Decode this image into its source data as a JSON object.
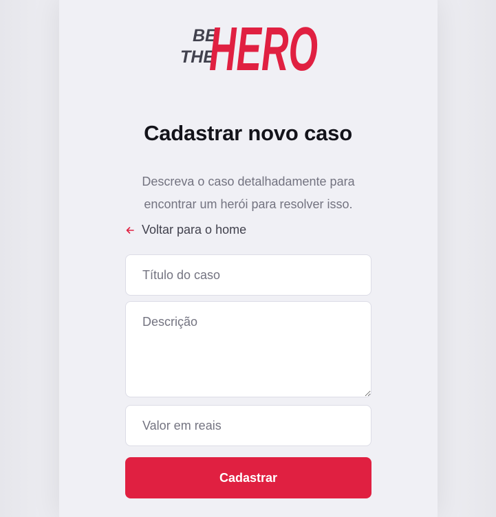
{
  "brand": {
    "logo_name": "Be The Hero",
    "logo_line1": "BE",
    "logo_line2": "THE",
    "logo_word": "HERO",
    "dark_color": "#41414d",
    "accent_color": "#e02041"
  },
  "page": {
    "title": "Cadastrar novo caso",
    "description": "Descreva o caso detalhadamente para encontrar um herói para resolver isso."
  },
  "nav": {
    "back_label": "Voltar para o home",
    "back_icon": "arrow-left-icon"
  },
  "form": {
    "title_field": {
      "placeholder": "Título do caso",
      "value": ""
    },
    "description_field": {
      "placeholder": "Descrição",
      "value": ""
    },
    "value_field": {
      "placeholder": "Valor em reais",
      "value": ""
    },
    "submit_label": "Cadastrar"
  }
}
